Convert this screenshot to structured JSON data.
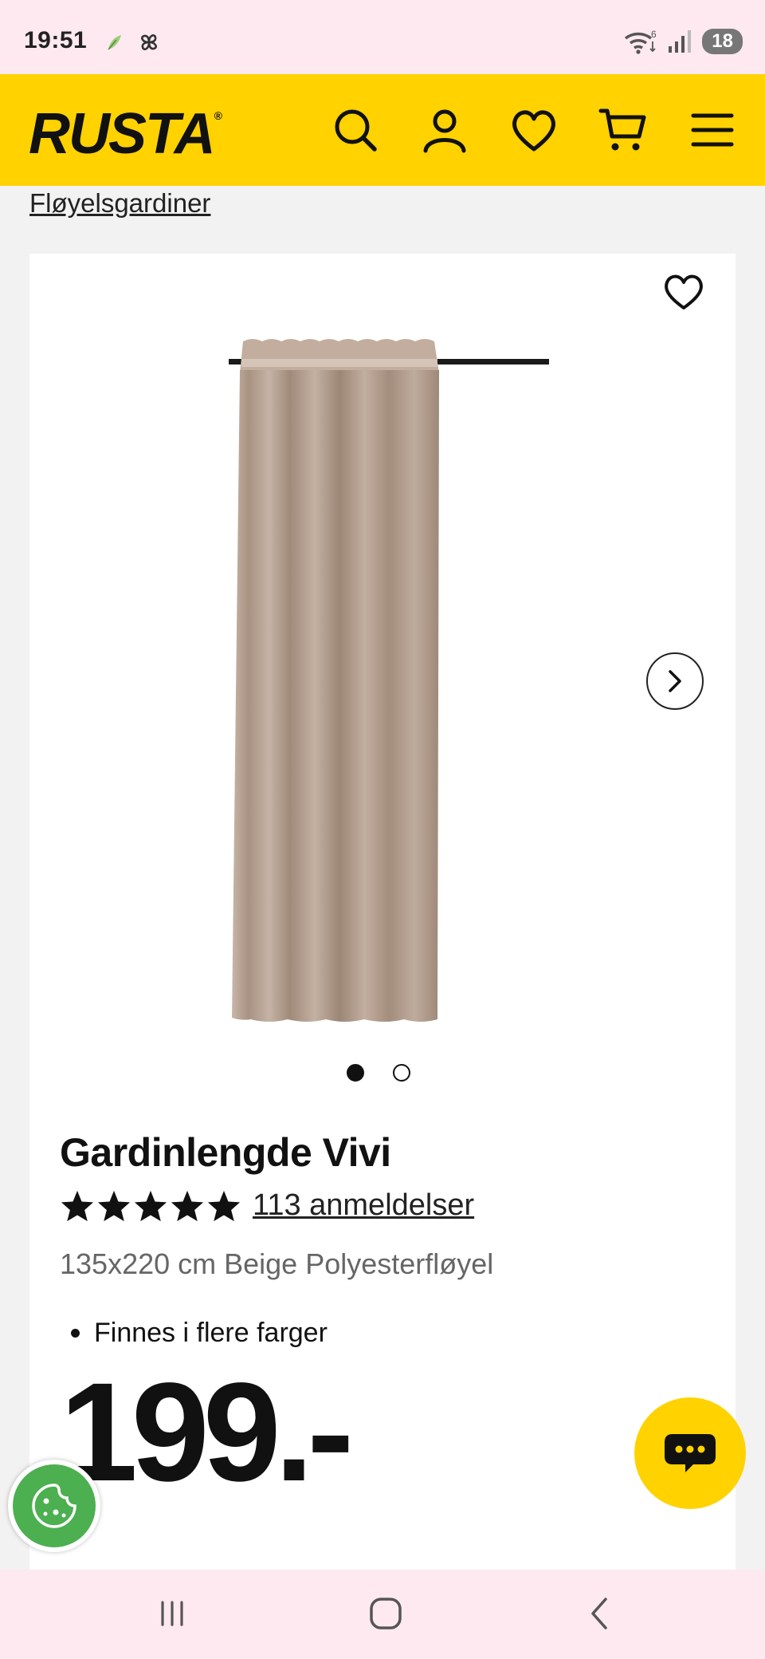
{
  "status_bar": {
    "time": "19:51",
    "battery": "18",
    "network_badge": "6",
    "icons": [
      "leaf-notification-icon",
      "pinwheel-notification-icon",
      "wifi-icon",
      "signal-icon",
      "battery-icon"
    ]
  },
  "header": {
    "logo_text": "RUSTA",
    "logo_mark": "®",
    "brand_color": "#ffd200",
    "icons": [
      "search-icon",
      "account-icon",
      "heart-icon",
      "cart-icon",
      "menu-icon"
    ]
  },
  "breadcrumb": {
    "label": "Fløyelsgardiner"
  },
  "product": {
    "title": "Gardinlengde Vivi",
    "rating_stars": 5,
    "reviews_label": "113 anmeldelser",
    "subtitle": "135x220 cm Beige Polyesterfløyel",
    "features": [
      "Finnes i flere farger"
    ],
    "price": "199.-",
    "image_count": 2,
    "active_image": 1,
    "curtain_color": "#b39e90"
  },
  "nav_bar": {
    "icons": [
      "recent-apps-icon",
      "home-icon",
      "back-icon"
    ]
  }
}
